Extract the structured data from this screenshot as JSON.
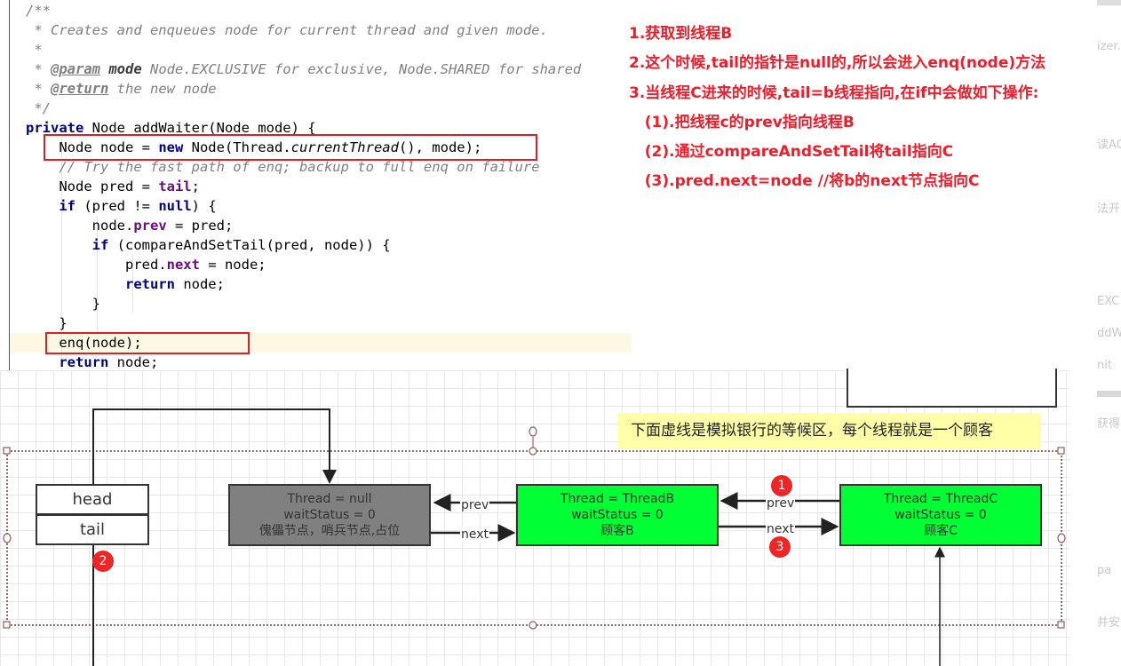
{
  "code": {
    "lines": [
      [
        [
          "/**",
          "cm"
        ]
      ],
      [
        [
          " * Creates and enqueues node for current thread and given mode.",
          "cm"
        ]
      ],
      [
        [
          " *",
          "cm"
        ]
      ],
      [
        [
          " * ",
          "cm"
        ],
        [
          "@param",
          "tag"
        ],
        [
          " mode",
          "pm"
        ],
        [
          " Node.EXCLUSIVE for exclusive, Node.SHARED for shared",
          "cm"
        ]
      ],
      [
        [
          " * ",
          "cm"
        ],
        [
          "@return",
          "tag"
        ],
        [
          " the new node",
          "cm"
        ]
      ],
      [
        [
          " */",
          "cm"
        ]
      ],
      [
        [
          "private",
          "kw"
        ],
        [
          " Node addWaiter(Node mode) {",
          ""
        ]
      ],
      [
        [
          "    Node node = ",
          ""
        ],
        [
          "new",
          "kw"
        ],
        [
          " Node(Thread.",
          ""
        ],
        [
          "currentThread",
          "it"
        ],
        [
          "(), mode);",
          ""
        ]
      ],
      [
        [
          "    // Try the fast path of enq; backup to full enq on failure",
          "cm"
        ]
      ],
      [
        [
          "    Node pred = ",
          ""
        ],
        [
          "tail",
          "fd"
        ],
        [
          ";",
          ""
        ]
      ],
      [
        [
          "    ",
          ""
        ],
        [
          "if",
          "kw"
        ],
        [
          " (pred != ",
          ""
        ],
        [
          "null",
          "kw"
        ],
        [
          ") {",
          ""
        ]
      ],
      [
        [
          "        node.",
          ""
        ],
        [
          "prev",
          "fd"
        ],
        [
          " = pred;",
          ""
        ]
      ],
      [
        [
          "        ",
          ""
        ],
        [
          "if",
          "kw"
        ],
        [
          " (compareAndSetTail(pred, node)) {",
          ""
        ]
      ],
      [
        [
          "            pred.",
          ""
        ],
        [
          "next",
          "fd"
        ],
        [
          " = node;",
          ""
        ]
      ],
      [
        [
          "            ",
          ""
        ],
        [
          "return",
          "kw"
        ],
        [
          " node;",
          ""
        ]
      ],
      [
        [
          "        }",
          ""
        ]
      ],
      [
        [
          "    }",
          ""
        ]
      ],
      [
        [
          "    enq(node);",
          ""
        ]
      ],
      [
        [
          "    ",
          ""
        ],
        [
          "return",
          "kw"
        ],
        [
          " node;",
          ""
        ]
      ]
    ]
  },
  "notes": [
    "1.获取到线程B",
    "2.这个时候,tail的指针是null的,所以会进入enq(node)方法",
    "3.当线程C进来的时候,tail=b线程指向,在if中会做如下操作:",
    "   (1).把线程c的prev指向线程B",
    "   (2).通过compareAndSetTail将tail指向C",
    "   (3).pred.next=node //将b的next节点指向C"
  ],
  "diagram": {
    "callout": "下面虚线是模拟银行的等候区，每个线程就是一个顾客",
    "head": "head",
    "tail": "tail",
    "sentinel": [
      "Thread = null",
      "waitStatus = 0",
      "傀儡节点，哨兵节点,占位"
    ],
    "nodeB": [
      "Thread = ThreadB",
      "waitStatus = 0",
      "顾客B"
    ],
    "nodeC": [
      "Thread = ThreadC",
      "waitStatus = 0",
      "顾客C"
    ],
    "labels": {
      "prev": "prev",
      "next": "next"
    },
    "badges": [
      "1",
      "2",
      "3"
    ],
    "colors": {
      "sentinel": "#808080",
      "node": "#00ff33",
      "callout": "#ffffa8",
      "badge": "#f02525",
      "annotation": "#f01c2a"
    }
  },
  "side_fragments": [
    "izer.",
    "读AC",
    "法开",
    "EXC",
    "ddW",
    "nit",
    "获得",
    "pa",
    "并安"
  ]
}
